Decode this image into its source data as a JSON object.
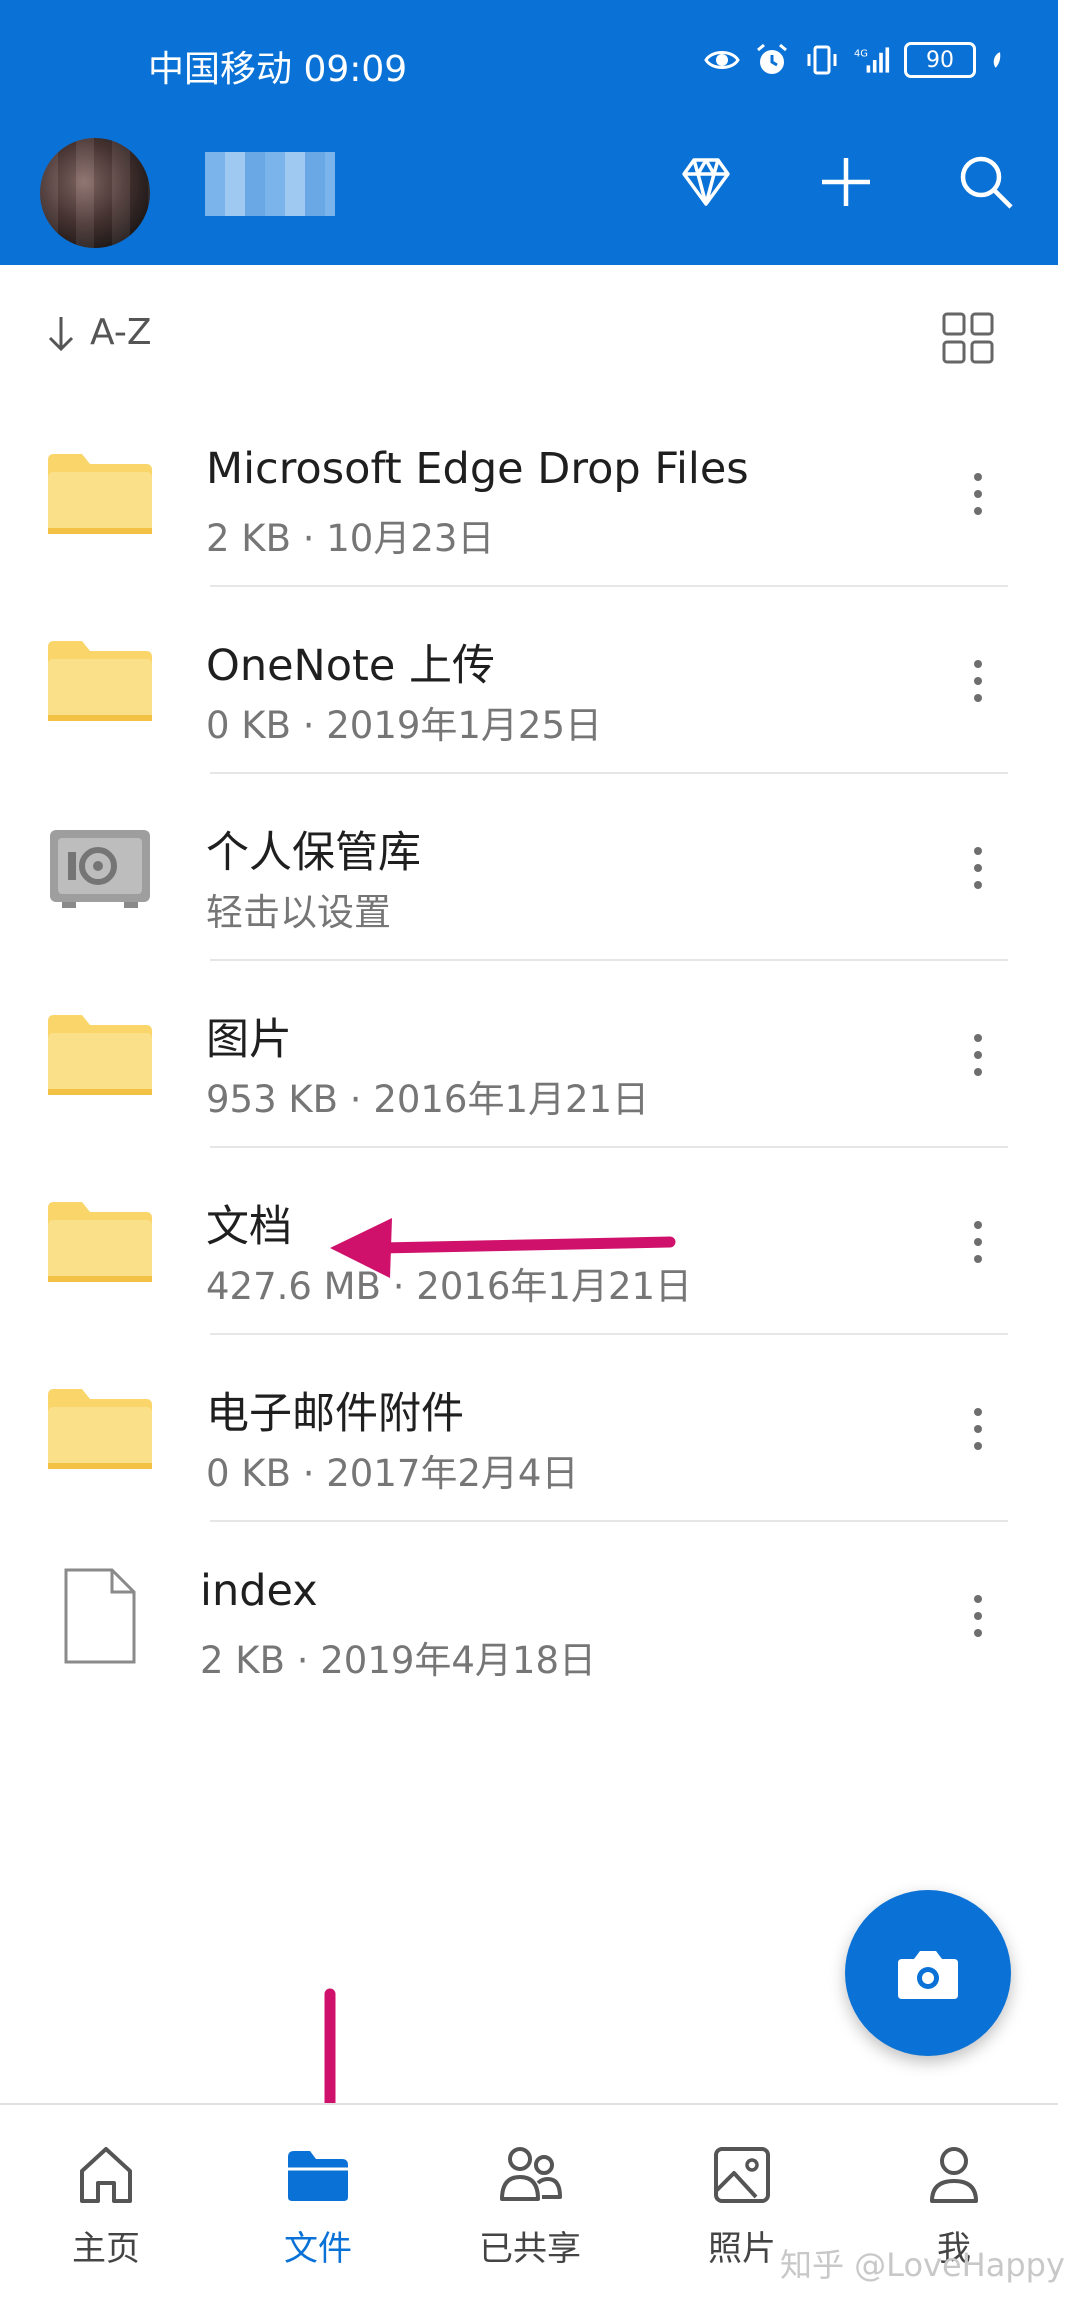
{
  "status_bar": {
    "carrier_time": "中国移动 09:09",
    "battery": "90",
    "icons": [
      "eye-icon",
      "alarm-icon",
      "vibrate-icon",
      "signal-icon",
      "leaf-icon"
    ]
  },
  "header": {
    "actions": [
      "diamond-icon",
      "plus-icon",
      "search-icon"
    ]
  },
  "sort": {
    "label": "A-Z"
  },
  "files": [
    {
      "name": "Microsoft Edge Drop Files",
      "meta": "2 KB · 10月23日",
      "type": "folder"
    },
    {
      "name": "OneNote 上传",
      "meta": "0 KB · 2019年1月25日",
      "type": "folder"
    },
    {
      "name": "个人保管库",
      "meta": "轻击以设置",
      "type": "vault"
    },
    {
      "name": "图片",
      "meta": "953 KB · 2016年1月21日",
      "type": "folder"
    },
    {
      "name": "文档",
      "meta": "427.6 MB · 2016年1月21日",
      "type": "folder"
    },
    {
      "name": "电子邮件附件",
      "meta": "0 KB · 2017年2月4日",
      "type": "folder"
    },
    {
      "name": "index",
      "meta": "2 KB · 2019年4月18日",
      "type": "file"
    }
  ],
  "nav": [
    {
      "label": "主页",
      "icon": "home-icon",
      "active": false
    },
    {
      "label": "文件",
      "icon": "folder-icon",
      "active": true
    },
    {
      "label": "已共享",
      "icon": "people-icon",
      "active": false
    },
    {
      "label": "照片",
      "icon": "photo-icon",
      "active": false
    },
    {
      "label": "我",
      "icon": "person-icon",
      "active": false
    }
  ],
  "watermark": "知乎 @LoveHappy",
  "colors": {
    "brand": "#0a72d6",
    "folder": "#f9d56a",
    "annotation": "#d0116b"
  }
}
